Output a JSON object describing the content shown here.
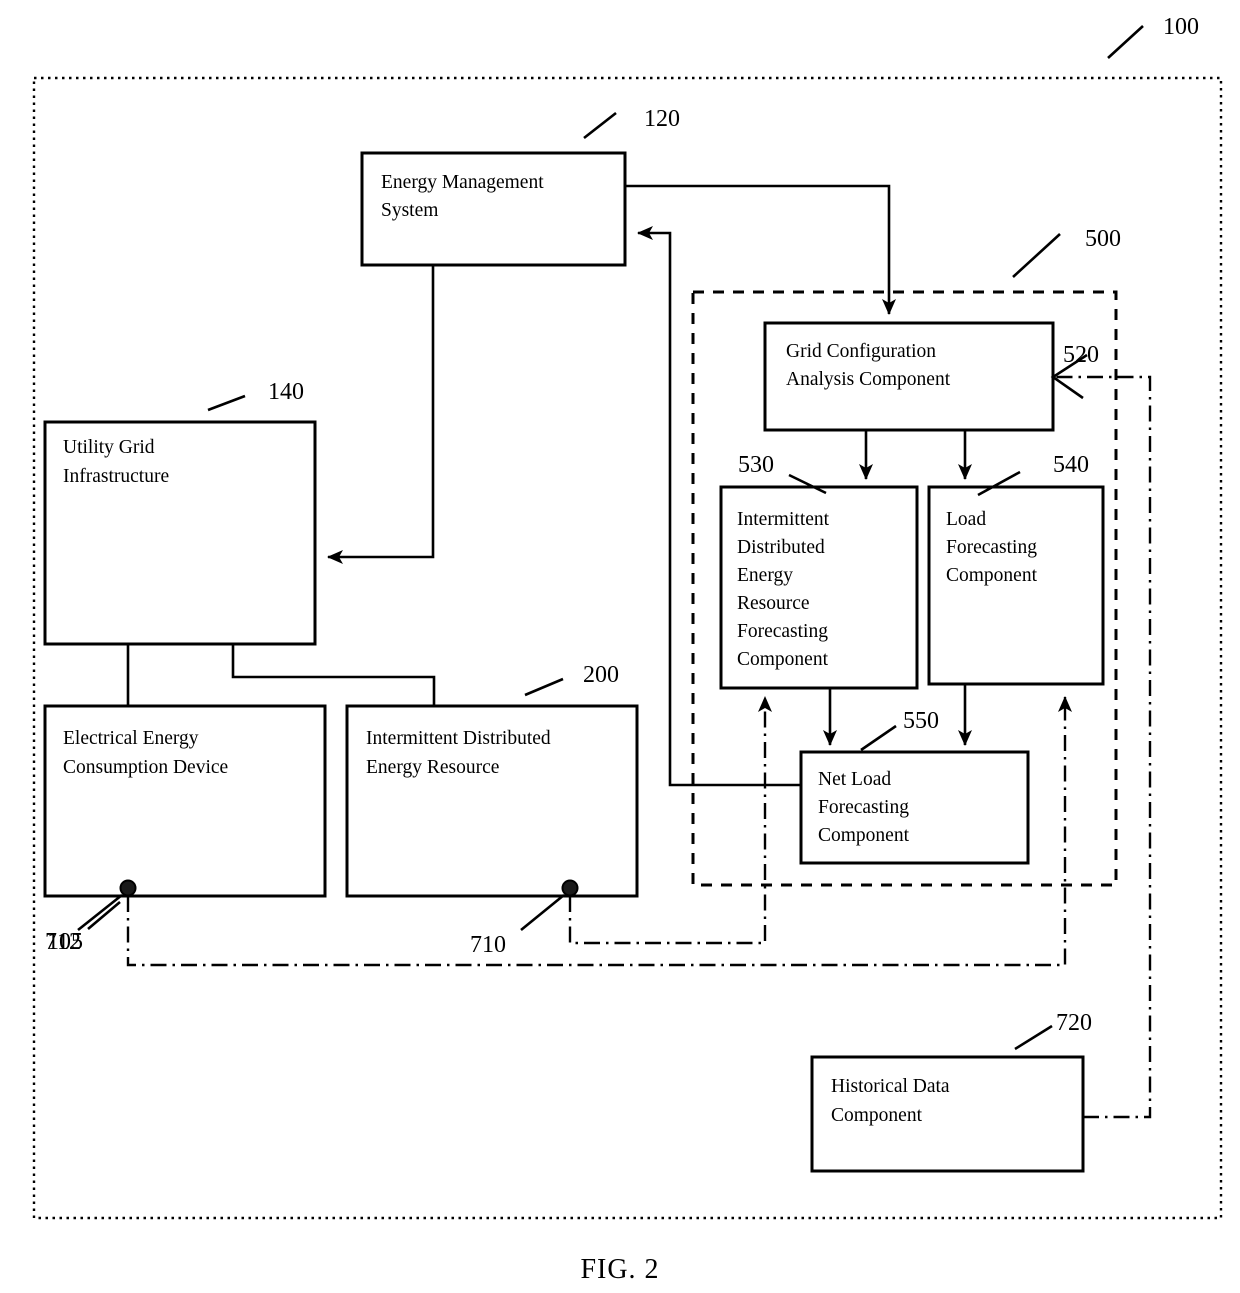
{
  "figure": {
    "caption": "FIG. 2",
    "outer_ref": "100"
  },
  "boxes": {
    "ems": {
      "ref": "120",
      "lines": [
        "Energy Management",
        "System"
      ]
    },
    "utility_grid": {
      "ref": "140",
      "lines": [
        "Utility Grid",
        "Infrastructure"
      ]
    },
    "consumption_device": {
      "ref": "105",
      "lines": [
        "Electrical Energy",
        "Consumption Device"
      ]
    },
    "ider": {
      "ref": "200",
      "lines": [
        "Intermittent Distributed",
        "Energy Resource"
      ]
    },
    "grid_config": {
      "ref": "520",
      "lines": [
        "Grid Configuration",
        "Analysis Component"
      ]
    },
    "ider_forecast": {
      "ref": "530",
      "lines": [
        "Intermittent",
        "Distributed",
        "Energy",
        "Resource",
        "Forecasting",
        "Component"
      ]
    },
    "load_forecast": {
      "ref": "540",
      "lines": [
        "Load",
        "Forecasting",
        "Component"
      ]
    },
    "net_load_forecast": {
      "ref": "550",
      "lines": [
        "Net Load",
        "Forecasting",
        "Component"
      ]
    },
    "historical_data": {
      "ref": "720",
      "lines": [
        "Historical Data",
        "Component"
      ]
    }
  },
  "groups": {
    "forecasting_subsystem": {
      "ref": "500"
    }
  },
  "sensors": {
    "ider_sensor": {
      "ref": "710"
    },
    "consumption_sensor": {
      "ref": "712"
    }
  },
  "colors": {
    "line": "#000000",
    "background": "#ffffff"
  }
}
